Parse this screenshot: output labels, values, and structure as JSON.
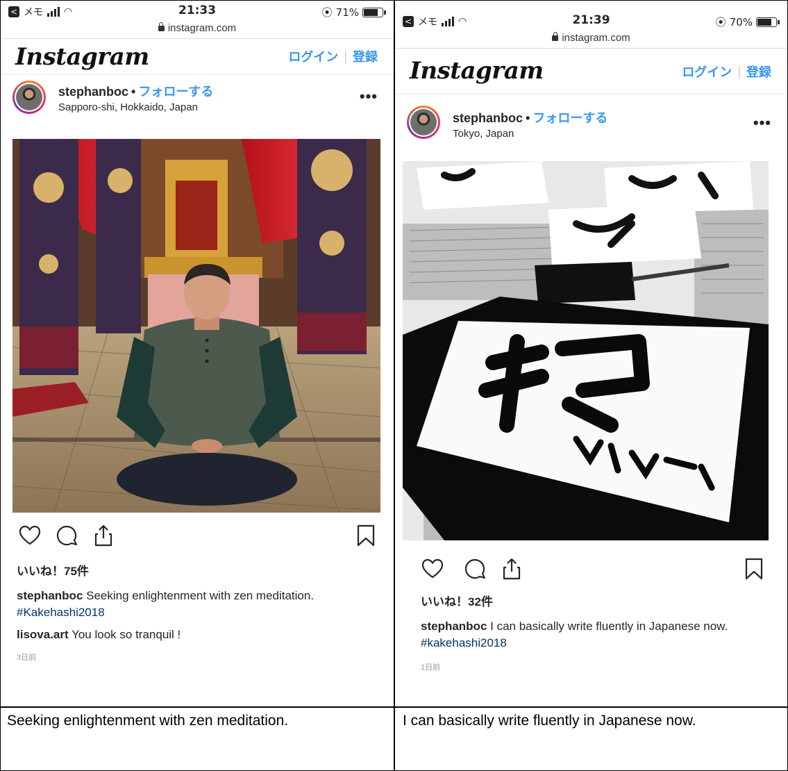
{
  "left": {
    "status": {
      "carrier": "メモ",
      "time": "21:33",
      "battery": "71%",
      "battery_level": 0.71
    },
    "url": "instagram.com",
    "header": {
      "logo": "Instagram",
      "login": "ログイン",
      "separator": "|",
      "signup": "登録"
    },
    "post": {
      "username": "stephanboc",
      "follow": "フォローする",
      "location": "Sapporo-shi, Hokkaido, Japan",
      "more": "•••",
      "likes": "いいね！75件",
      "caption_user": "stephanboc",
      "caption_text": "Seeking enlightenment with zen meditation.",
      "hashtag": "#Kakehashi2018",
      "comment_user": "lisova.art",
      "comment_text": "You look so tranquil !",
      "time_ago": "3日前",
      "icons": [
        "heart-icon",
        "comment-icon",
        "share-icon",
        "bookmark-icon"
      ]
    }
  },
  "right": {
    "status": {
      "carrier": "メモ",
      "time": "21:39",
      "battery": "70%",
      "battery_level": 0.7
    },
    "url": "instagram.com",
    "header": {
      "logo": "Instagram",
      "login": "ログイン",
      "separator": "|",
      "signup": "登録"
    },
    "post": {
      "username": "stephanboc",
      "follow": "フォローする",
      "location": "Tokyo, Japan",
      "more": "•••",
      "likes": "いいね！32件",
      "caption_user": "stephanboc",
      "caption_text": "I can basically write fluently in Japanese now.",
      "hashtag": "#kakehashi2018",
      "time_ago": "1日前",
      "icons": [
        "heart-icon",
        "comment-icon",
        "share-icon",
        "bookmark-icon"
      ]
    }
  },
  "captions": {
    "left": "Seeking enlightenment with zen meditation.",
    "right": "I can basically write fluently in Japanese now."
  },
  "colors": {
    "link": "#3897f0",
    "hashtag": "#003569",
    "text": "#262626"
  }
}
